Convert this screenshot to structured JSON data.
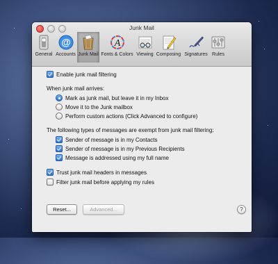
{
  "window": {
    "title": "Junk Mail"
  },
  "toolbar": {
    "items": [
      {
        "label": "General",
        "icon": "general-switch-icon"
      },
      {
        "label": "Accounts",
        "icon": "at-sign-icon"
      },
      {
        "label": "Junk Mail",
        "icon": "junk-mail-bin-icon",
        "selected": true
      },
      {
        "label": "Fonts & Colors",
        "icon": "font-colors-icon"
      },
      {
        "label": "Viewing",
        "icon": "viewing-glasses-icon"
      },
      {
        "label": "Composing",
        "icon": "composing-pencil-icon"
      },
      {
        "label": "Signatures",
        "icon": "signature-pen-icon"
      },
      {
        "label": "Rules",
        "icon": "rules-icon"
      }
    ]
  },
  "junk": {
    "enable_label": "Enable junk mail filtering",
    "enable_checked": true,
    "arrives_heading": "When junk mail arrives:",
    "arrival_options": [
      {
        "label": "Mark as junk mail, but leave it in my Inbox",
        "selected": true
      },
      {
        "label": "Move it to the Junk mailbox",
        "selected": false
      },
      {
        "label": "Perform custom actions (Click Advanced to configure)",
        "selected": false
      }
    ],
    "exempt_heading": "The following types of messages are exempt from junk mail filtering:",
    "exempt_options": [
      {
        "label": "Sender of message is in my Contacts",
        "checked": true
      },
      {
        "label": "Sender of message is in my Previous Recipients",
        "checked": true
      },
      {
        "label": "Message is addressed using my full name",
        "checked": true
      }
    ],
    "trust_label": "Trust junk mail headers in messages",
    "trust_checked": true,
    "filter_label": "Filter junk mail before applying my rules",
    "filter_checked": false
  },
  "buttons": {
    "reset_label": "Reset...",
    "advanced_label": "Advanced...",
    "advanced_enabled": false,
    "help_label": "?"
  },
  "colors": {
    "accent": "#2f72cf",
    "close_button": "#d0342c"
  }
}
